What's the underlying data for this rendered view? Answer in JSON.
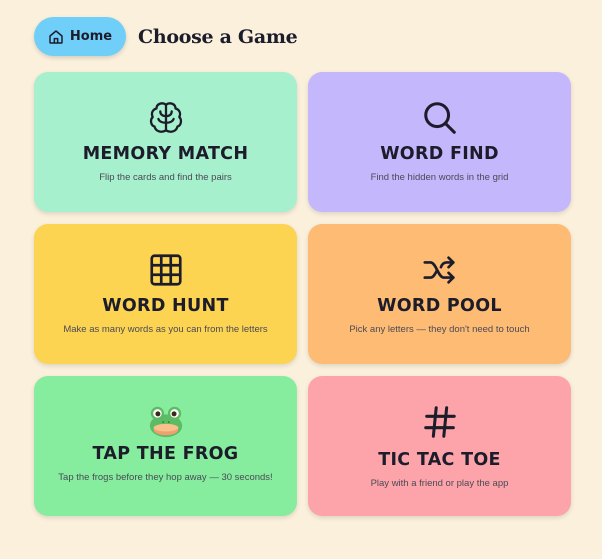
{
  "header": {
    "home_label": "Home",
    "page_title": "Choose a Game"
  },
  "colors": {
    "background": "#faf0dc",
    "home_button": "#6fcff9",
    "memory_match": "#a6f0cd",
    "word_find": "#c4b7fb",
    "word_hunt": "#fcd452",
    "word_pool": "#fdbb74",
    "tap_the_frog": "#86ed9f",
    "tic_tac_toe": "#fda4aa"
  },
  "games": [
    {
      "id": "memory-match",
      "icon": "brain-icon",
      "title": "MEMORY MATCH",
      "subtitle": "Flip the cards and find the pairs"
    },
    {
      "id": "word-find",
      "icon": "magnifier-icon",
      "title": "WORD FIND",
      "subtitle": "Find the hidden words in the grid"
    },
    {
      "id": "word-hunt",
      "icon": "grid-icon",
      "title": "WORD HUNT",
      "subtitle": "Make as many words as you can from the letters"
    },
    {
      "id": "word-pool",
      "icon": "shuffle-icon",
      "title": "WORD POOL",
      "subtitle": "Pick any letters — they don't need to touch"
    },
    {
      "id": "tap-the-frog",
      "icon": "frog-icon",
      "title": "TAP THE FROG",
      "subtitle": "Tap the frogs before they hop away — 30 seconds!"
    },
    {
      "id": "tic-tac-toe",
      "icon": "hash-icon",
      "title": "TIC TAC TOE",
      "subtitle": "Play with a friend or play the app"
    }
  ]
}
